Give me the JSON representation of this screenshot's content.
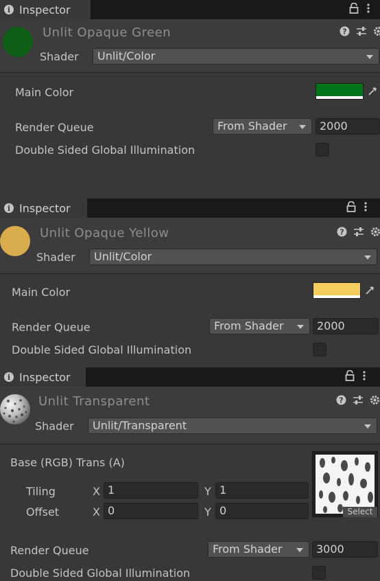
{
  "panels": [
    {
      "tab_label": "Inspector",
      "material_name": "Unlit Opaque Green",
      "shader_label": "Shader",
      "shader_value": "Unlit/Color",
      "main_color_label": "Main Color",
      "main_color": "#00741a",
      "render_queue_label": "Render Queue",
      "render_queue_mode": "From Shader",
      "render_queue_value": "2000",
      "gi_label": "Double Sided Global Illumination"
    },
    {
      "tab_label": "Inspector",
      "material_name": "Unlit Opaque Yellow",
      "shader_label": "Shader",
      "shader_value": "Unlit/Color",
      "main_color_label": "Main Color",
      "main_color": "#f5cd5f",
      "render_queue_label": "Render Queue",
      "render_queue_mode": "From Shader",
      "render_queue_value": "2000",
      "gi_label": "Double Sided Global Illumination"
    },
    {
      "tab_label": "Inspector",
      "material_name": "Unlit Transparent",
      "shader_label": "Shader",
      "shader_value": "Unlit/Transparent",
      "texture_label": "Base (RGB) Trans (A)",
      "tiling_label": "Tiling",
      "offset_label": "Offset",
      "tiling_x": "1",
      "tiling_y": "1",
      "offset_x": "0",
      "offset_y": "0",
      "x_label": "X",
      "y_label": "Y",
      "select_label": "Select",
      "render_queue_label": "Render Queue",
      "render_queue_mode": "From Shader",
      "render_queue_value": "3000",
      "gi_label": "Double Sided Global Illumination"
    }
  ],
  "colors": {
    "background": "#383838",
    "tab_bar": "#191919",
    "green_preview": "#0f5f17",
    "yellow_preview": "#d9ad4d"
  },
  "icons": [
    "info-icon",
    "lock-icon",
    "kebab-menu-icon",
    "help-icon",
    "preset-sliders-icon",
    "gear-icon",
    "eyedropper-icon",
    "dropdown-arrow-icon"
  ]
}
